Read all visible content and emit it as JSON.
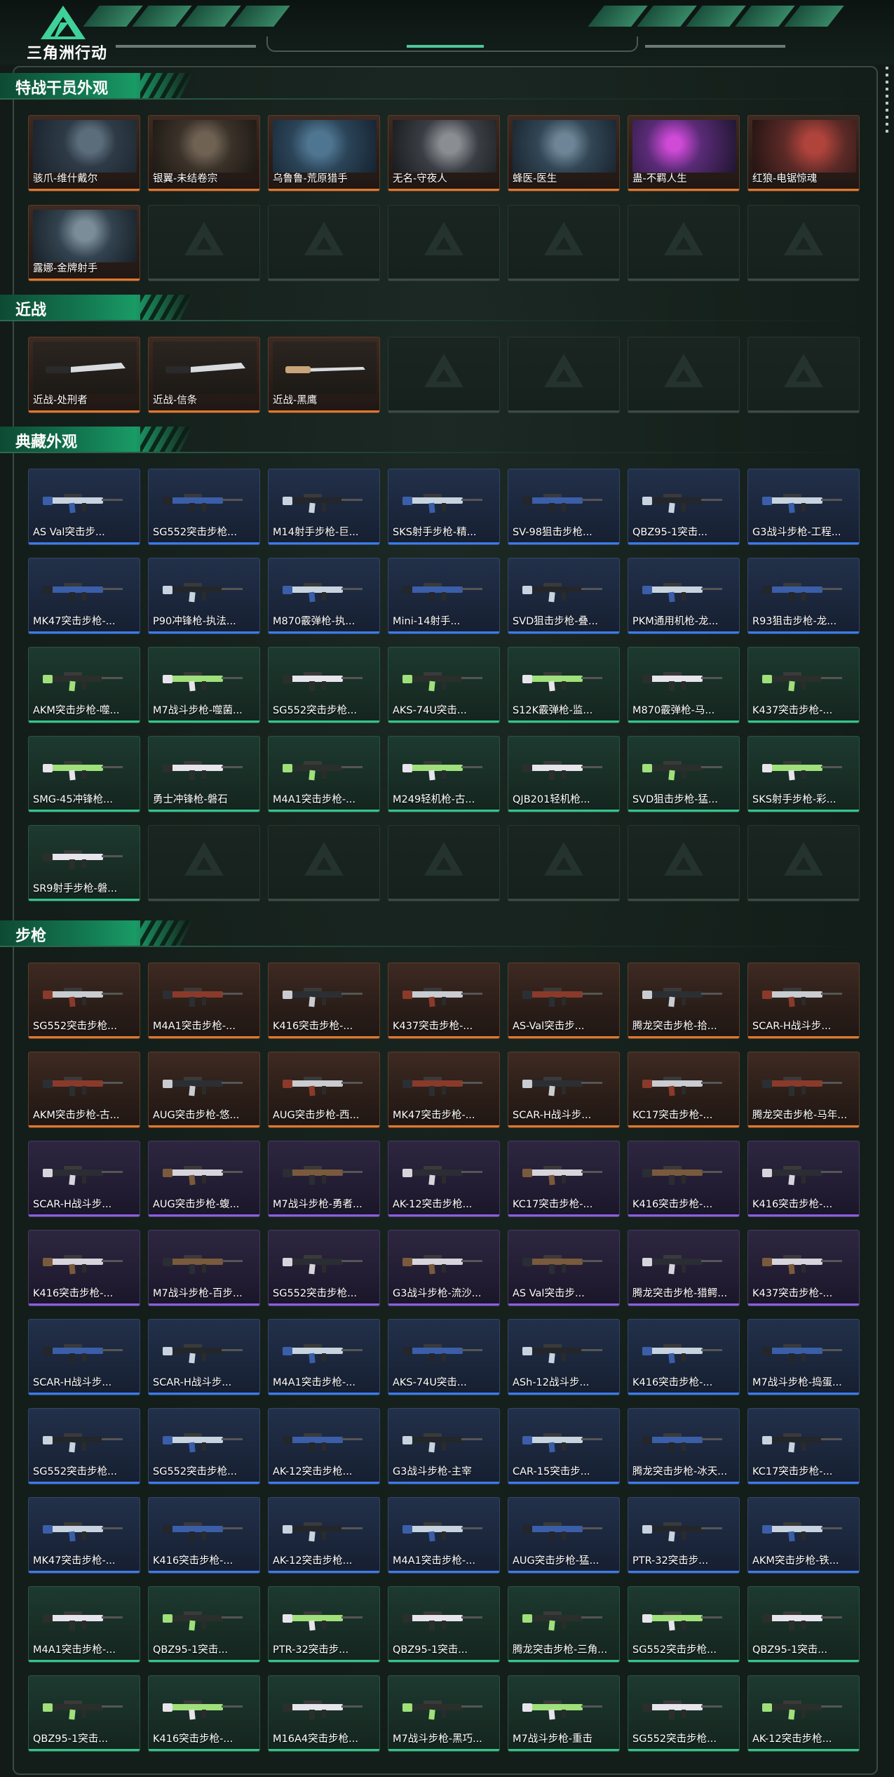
{
  "header": {
    "logo_text": "三角洲行动",
    "colors": {
      "accent": "#34c48a",
      "header_bg": "#0c1412"
    }
  },
  "rarity_colors": {
    "orange": "#e0782c",
    "purple": "#8b5ee0",
    "blue": "#3b7bea",
    "green": "#34c48a"
  },
  "sections": [
    {
      "title": "特战干员外观",
      "cards": [
        {
          "label": "骇爪-维什戴尔",
          "rarity": "orange",
          "art": "p1"
        },
        {
          "label": "银翼-未结卷宗",
          "rarity": "orange",
          "art": "p2"
        },
        {
          "label": "乌鲁鲁-荒原猎手",
          "rarity": "orange",
          "art": "p3"
        },
        {
          "label": "无名-守夜人",
          "rarity": "orange",
          "art": "p4"
        },
        {
          "label": "蜂医-医生",
          "rarity": "orange",
          "art": "p5"
        },
        {
          "label": "蛊-不羁人生",
          "rarity": "orange",
          "art": "p6"
        },
        {
          "label": "红狼-电锯惊魂",
          "rarity": "orange",
          "art": "p7"
        },
        {
          "label": "露娜-金牌射手",
          "rarity": "orange",
          "art": "p8"
        }
      ],
      "empty_slots": 6
    },
    {
      "title": "近战",
      "cards": [
        {
          "label": "近战-处刑者",
          "rarity": "orange",
          "art": "melee"
        },
        {
          "label": "近战-信条",
          "rarity": "orange",
          "art": "melee"
        },
        {
          "label": "近战-黑鹰",
          "rarity": "orange",
          "art": "melee"
        }
      ],
      "empty_slots": 4
    },
    {
      "title": "典藏外观",
      "cards": [
        {
          "label": "AS Val突击步...",
          "rarity": "blue"
        },
        {
          "label": "SG552突击步枪...",
          "rarity": "blue"
        },
        {
          "label": "M14射手步枪-巨...",
          "rarity": "blue"
        },
        {
          "label": "SKS射手步枪-精...",
          "rarity": "blue"
        },
        {
          "label": "SV-98狙击步枪...",
          "rarity": "blue"
        },
        {
          "label": "QBZ95-1突击...",
          "rarity": "blue"
        },
        {
          "label": "G3战斗步枪-工程...",
          "rarity": "blue"
        },
        {
          "label": "MK47突击步枪-...",
          "rarity": "blue"
        },
        {
          "label": "P90冲锋枪-执法...",
          "rarity": "blue"
        },
        {
          "label": "M870霰弹枪-执...",
          "rarity": "blue"
        },
        {
          "label": "Mini-14射手...",
          "rarity": "blue"
        },
        {
          "label": "SVD狙击步枪-叠...",
          "rarity": "blue"
        },
        {
          "label": "PKM通用机枪-龙...",
          "rarity": "blue"
        },
        {
          "label": "R93狙击步枪-龙...",
          "rarity": "blue"
        },
        {
          "label": "AKM突击步枪-噬...",
          "rarity": "green"
        },
        {
          "label": "M7战斗步枪-噬菌...",
          "rarity": "green"
        },
        {
          "label": "SG552突击步枪...",
          "rarity": "green"
        },
        {
          "label": "AKS-74U突击...",
          "rarity": "green"
        },
        {
          "label": "S12K霰弹枪-监...",
          "rarity": "green"
        },
        {
          "label": "M870霰弹枪-马...",
          "rarity": "green"
        },
        {
          "label": "K437突击步枪-...",
          "rarity": "green"
        },
        {
          "label": "SMG-45冲锋枪...",
          "rarity": "green"
        },
        {
          "label": "勇士冲锋枪-磐石",
          "rarity": "green"
        },
        {
          "label": "M4A1突击步枪-...",
          "rarity": "green"
        },
        {
          "label": "M249轻机枪-古...",
          "rarity": "green"
        },
        {
          "label": "QJB201轻机枪...",
          "rarity": "green"
        },
        {
          "label": "SVD狙击步枪-猛...",
          "rarity": "green"
        },
        {
          "label": "SKS射手步枪-彩...",
          "rarity": "green"
        },
        {
          "label": "SR9射手步枪-磐...",
          "rarity": "green"
        }
      ],
      "empty_slots": 6
    },
    {
      "title": "步枪",
      "cards": [
        {
          "label": "SG552突击步枪...",
          "rarity": "orange"
        },
        {
          "label": "M4A1突击步枪-...",
          "rarity": "orange"
        },
        {
          "label": "K416突击步枪-...",
          "rarity": "orange"
        },
        {
          "label": "K437突击步枪-...",
          "rarity": "orange"
        },
        {
          "label": "AS-Val突击步...",
          "rarity": "orange"
        },
        {
          "label": "腾龙突击步枪-拾...",
          "rarity": "orange"
        },
        {
          "label": "SCAR-H战斗步...",
          "rarity": "orange"
        },
        {
          "label": "AKM突击步枪-古...",
          "rarity": "orange"
        },
        {
          "label": "AUG突击步枪-悠...",
          "rarity": "orange"
        },
        {
          "label": "AUG突击步枪-西...",
          "rarity": "orange"
        },
        {
          "label": "MK47突击步枪-...",
          "rarity": "orange"
        },
        {
          "label": "SCAR-H战斗步...",
          "rarity": "orange"
        },
        {
          "label": "KC17突击步枪-...",
          "rarity": "orange"
        },
        {
          "label": "腾龙突击步枪-马年...",
          "rarity": "orange"
        },
        {
          "label": "SCAR-H战斗步...",
          "rarity": "purple"
        },
        {
          "label": "AUG突击步枪-蝮...",
          "rarity": "purple"
        },
        {
          "label": "M7战斗步枪-勇者...",
          "rarity": "purple"
        },
        {
          "label": "AK-12突击步枪...",
          "rarity": "purple"
        },
        {
          "label": "KC17突击步枪-...",
          "rarity": "purple"
        },
        {
          "label": "K416突击步枪-...",
          "rarity": "purple"
        },
        {
          "label": "K416突击步枪-...",
          "rarity": "purple"
        },
        {
          "label": "K416突击步枪-...",
          "rarity": "purple"
        },
        {
          "label": "M7战斗步枪-百步...",
          "rarity": "purple"
        },
        {
          "label": "SG552突击步枪...",
          "rarity": "purple"
        },
        {
          "label": "G3战斗步枪-流沙...",
          "rarity": "purple"
        },
        {
          "label": "AS Val突击步...",
          "rarity": "purple"
        },
        {
          "label": "腾龙突击步枪-猎鳄...",
          "rarity": "purple"
        },
        {
          "label": "K437突击步枪-...",
          "rarity": "purple"
        },
        {
          "label": "SCAR-H战斗步...",
          "rarity": "blue"
        },
        {
          "label": "SCAR-H战斗步...",
          "rarity": "blue"
        },
        {
          "label": "M4A1突击步枪-...",
          "rarity": "blue"
        },
        {
          "label": "AKS-74U突击...",
          "rarity": "blue"
        },
        {
          "label": "ASh-12战斗步...",
          "rarity": "blue"
        },
        {
          "label": "K416突击步枪-...",
          "rarity": "blue"
        },
        {
          "label": "M7战斗步枪-捣蛋...",
          "rarity": "blue"
        },
        {
          "label": "SG552突击步枪...",
          "rarity": "blue"
        },
        {
          "label": "SG552突击步枪...",
          "rarity": "blue"
        },
        {
          "label": "AK-12突击步枪...",
          "rarity": "blue"
        },
        {
          "label": "G3战斗步枪-主宰",
          "rarity": "blue"
        },
        {
          "label": "CAR-15突击步...",
          "rarity": "blue"
        },
        {
          "label": "腾龙突击步枪-冰天...",
          "rarity": "blue"
        },
        {
          "label": "KC17突击步枪-...",
          "rarity": "blue"
        },
        {
          "label": "MK47突击步枪-...",
          "rarity": "blue"
        },
        {
          "label": "K416突击步枪-...",
          "rarity": "blue"
        },
        {
          "label": "AK-12突击步枪...",
          "rarity": "blue"
        },
        {
          "label": "M4A1突击步枪-...",
          "rarity": "blue"
        },
        {
          "label": "AUG突击步枪-猛...",
          "rarity": "blue"
        },
        {
          "label": "PTR-32突击步...",
          "rarity": "blue"
        },
        {
          "label": "AKM突击步枪-铁...",
          "rarity": "blue"
        },
        {
          "label": "M4A1突击步枪-...",
          "rarity": "green"
        },
        {
          "label": "QBZ95-1突击...",
          "rarity": "green"
        },
        {
          "label": "PTR-32突击步...",
          "rarity": "green"
        },
        {
          "label": "QBZ95-1突击...",
          "rarity": "green"
        },
        {
          "label": "腾龙突击步枪-三角...",
          "rarity": "green"
        },
        {
          "label": "SG552突击步枪...",
          "rarity": "green"
        },
        {
          "label": "QBZ95-1突击...",
          "rarity": "green"
        },
        {
          "label": "QBZ95-1突击...",
          "rarity": "green"
        },
        {
          "label": "K416突击步枪-...",
          "rarity": "green"
        },
        {
          "label": "M16A4突击步枪...",
          "rarity": "green"
        },
        {
          "label": "M7战斗步枪-黑巧...",
          "rarity": "green"
        },
        {
          "label": "M7战斗步枪-重击",
          "rarity": "green"
        },
        {
          "label": "SG552突击步枪...",
          "rarity": "green"
        },
        {
          "label": "AK-12突击步枪...",
          "rarity": "green"
        }
      ],
      "empty_slots": 0
    }
  ]
}
